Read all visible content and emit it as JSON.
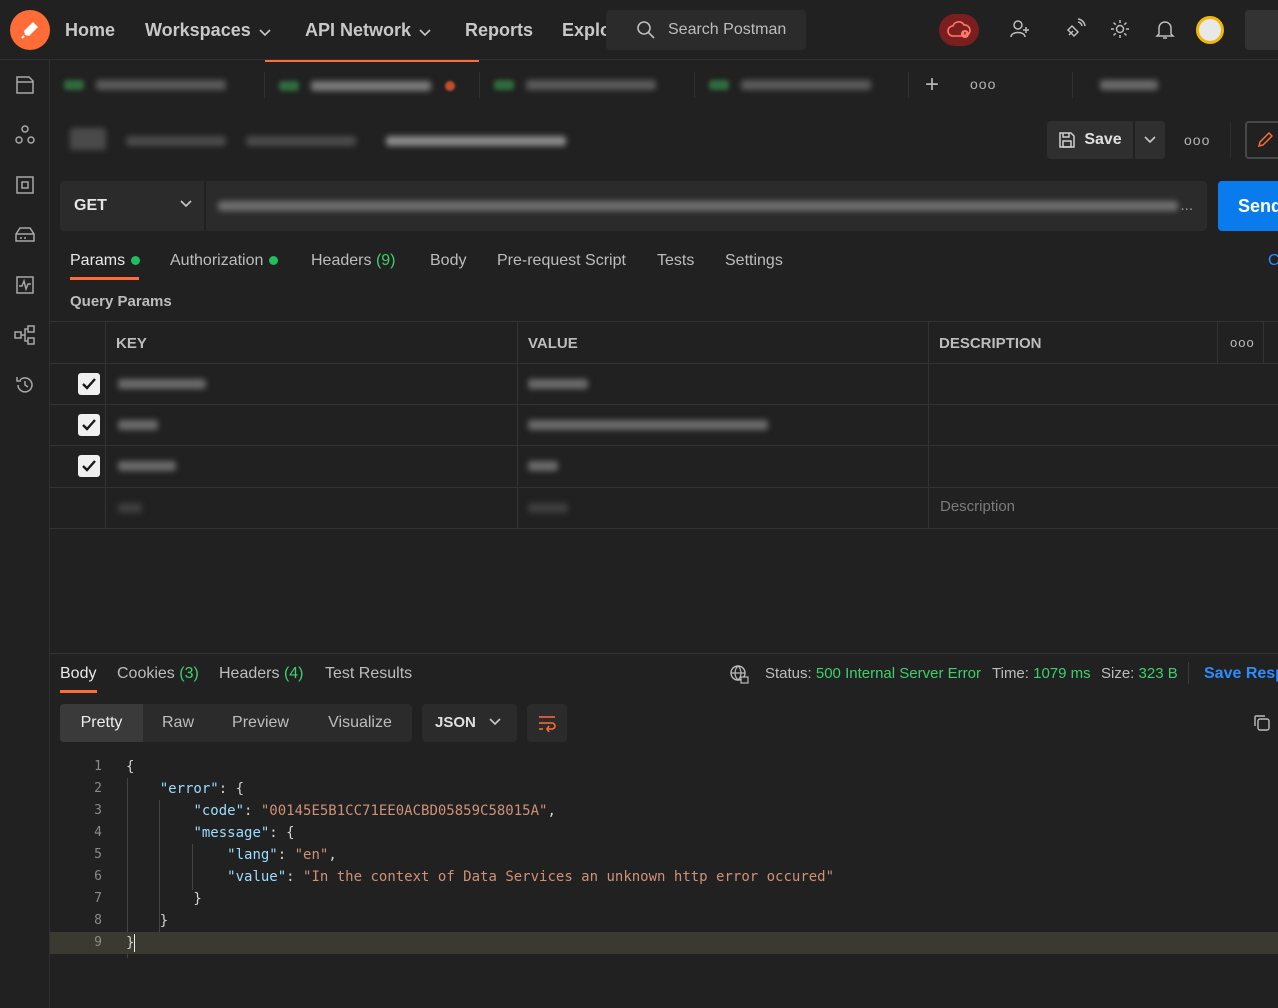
{
  "nav": {
    "home": "Home",
    "workspaces": "Workspaces",
    "api_network": "API Network",
    "reports": "Reports",
    "explore": "Explo",
    "search_placeholder": "Search Postman"
  },
  "breadcrumb": {
    "save_label": "Save"
  },
  "request": {
    "method": "GET",
    "send_label": "Send",
    "url_ellipsis": "..."
  },
  "request_tabs": {
    "params": "Params",
    "authorization": "Authorization",
    "headers": "Headers",
    "headers_count": "(9)",
    "body": "Body",
    "prerequest": "Pre-request Script",
    "tests": "Tests",
    "settings": "Settings",
    "cookies_stub": "C"
  },
  "query_params": {
    "title": "Query Params",
    "columns": [
      "KEY",
      "VALUE",
      "DESCRIPTION"
    ],
    "description_placeholder": "Description"
  },
  "response": {
    "tabs": {
      "body": "Body",
      "cookies": "Cookies",
      "cookies_count": "(3)",
      "headers": "Headers",
      "headers_count": "(4)",
      "test_results": "Test Results"
    },
    "status_label": "Status:",
    "status_value": "500 Internal Server Error",
    "time_label": "Time:",
    "time_value": "1079 ms",
    "size_label": "Size:",
    "size_value": "323 B",
    "save_response": "Save Resp",
    "view_options": [
      "Pretty",
      "Raw",
      "Preview",
      "Visualize"
    ],
    "format": "JSON"
  },
  "code_lines": [
    {
      "n": "1",
      "parts": [
        [
          "p",
          "{"
        ]
      ]
    },
    {
      "n": "2",
      "parts": [
        [
          "p",
          "    "
        ],
        [
          "k",
          "\"error\""
        ],
        [
          "p",
          ": {"
        ]
      ]
    },
    {
      "n": "3",
      "parts": [
        [
          "p",
          "        "
        ],
        [
          "k",
          "\"code\""
        ],
        [
          "p",
          ": "
        ],
        [
          "s",
          "\"00145E5B1CC71EE0ACBD05859C58015A\""
        ],
        [
          "p",
          ","
        ]
      ]
    },
    {
      "n": "4",
      "parts": [
        [
          "p",
          "        "
        ],
        [
          "k",
          "\"message\""
        ],
        [
          "p",
          ": {"
        ]
      ]
    },
    {
      "n": "5",
      "parts": [
        [
          "p",
          "            "
        ],
        [
          "k",
          "\"lang\""
        ],
        [
          "p",
          ": "
        ],
        [
          "s",
          "\"en\""
        ],
        [
          "p",
          ","
        ]
      ]
    },
    {
      "n": "6",
      "parts": [
        [
          "p",
          "            "
        ],
        [
          "k",
          "\"value\""
        ],
        [
          "p",
          ": "
        ],
        [
          "s",
          "\"In the context of Data Services an unknown http error occured\""
        ]
      ]
    },
    {
      "n": "7",
      "parts": [
        [
          "p",
          "        }"
        ]
      ]
    },
    {
      "n": "8",
      "parts": [
        [
          "p",
          "    }"
        ]
      ]
    },
    {
      "n": "9",
      "parts": [
        [
          "p",
          "}"
        ]
      ]
    }
  ],
  "colors": {
    "brand": "#ff6c37",
    "send": "#097bed",
    "status_ok_text": "#3ecf6c",
    "link": "#2d8cff"
  }
}
